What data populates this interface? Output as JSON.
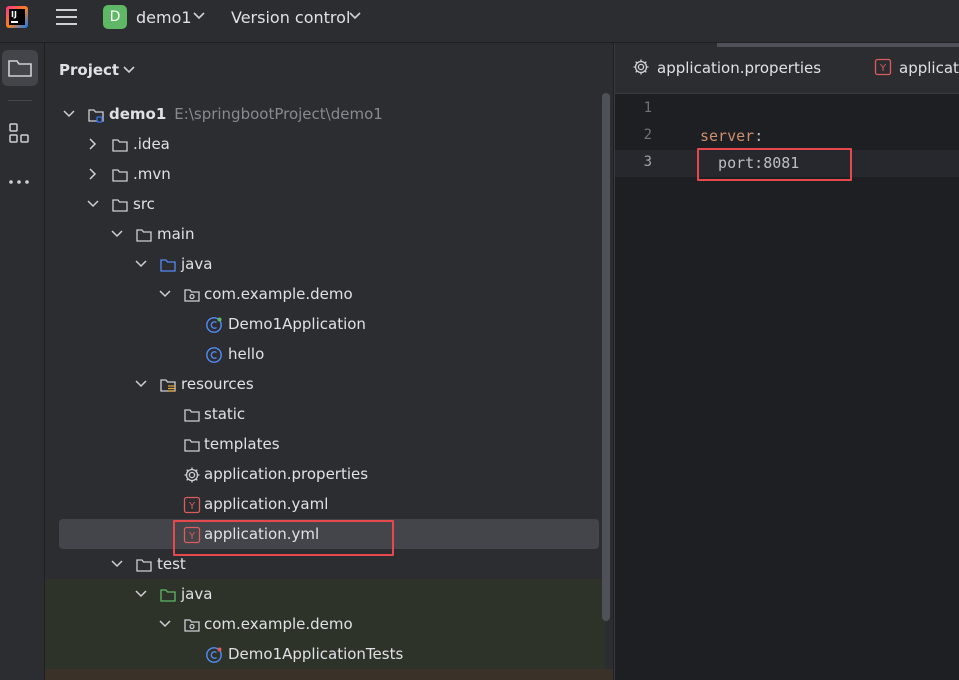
{
  "titlebar": {
    "app_logo": "intellij-logo",
    "project_badge_letter": "D",
    "project_name": "demo1",
    "vcs_label": "Version control"
  },
  "project_panel": {
    "title": "Project",
    "tree": [
      {
        "label": "demo1",
        "path": "E:\\springbootProject\\demo1",
        "icon": "module-folder-icon"
      },
      {
        "label": ".idea",
        "icon": "folder-icon"
      },
      {
        "label": ".mvn",
        "icon": "folder-icon"
      },
      {
        "label": "src",
        "icon": "folder-icon"
      },
      {
        "label": "main",
        "icon": "folder-icon"
      },
      {
        "label": "java",
        "icon": "source-folder-icon"
      },
      {
        "label": "com.example.demo",
        "icon": "package-icon"
      },
      {
        "label": "Demo1Application",
        "icon": "spring-class-icon"
      },
      {
        "label": "hello",
        "icon": "class-icon"
      },
      {
        "label": "resources",
        "icon": "resources-folder-icon"
      },
      {
        "label": "static",
        "icon": "folder-icon"
      },
      {
        "label": "templates",
        "icon": "folder-icon"
      },
      {
        "label": "application.properties",
        "icon": "properties-gear-icon"
      },
      {
        "label": "application.yaml",
        "icon": "yaml-file-icon"
      },
      {
        "label": "application.yml",
        "icon": "yaml-file-icon",
        "selected": true
      },
      {
        "label": "test",
        "icon": "folder-icon"
      },
      {
        "label": "java",
        "icon": "test-source-folder-icon"
      },
      {
        "label": "com.example.demo",
        "icon": "package-icon"
      },
      {
        "label": "Demo1ApplicationTests",
        "icon": "test-class-icon"
      }
    ]
  },
  "editor": {
    "tabs": [
      {
        "label": "application.properties",
        "icon": "properties-gear-icon"
      },
      {
        "label": "applicati",
        "icon": "yaml-file-icon"
      }
    ],
    "lines": [
      {
        "num": "1",
        "key": "",
        "value": ""
      },
      {
        "num": "2",
        "key": "server",
        "value": ":"
      },
      {
        "num": "3",
        "key": "",
        "value": "  port:8081"
      }
    ],
    "current_line": "3"
  },
  "colors": {
    "accent_red_highlight": "#e5484d",
    "yaml_key": "#cf8e6d",
    "badge_green": "#5fb865"
  }
}
